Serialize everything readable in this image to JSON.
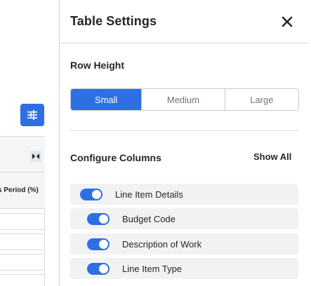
{
  "background_table": {
    "header_label": "s Period (%)"
  },
  "panel": {
    "title": "Table Settings",
    "close_icon": "close-icon",
    "row_height": {
      "label": "Row Height",
      "options": [
        "Small",
        "Medium",
        "Large"
      ],
      "selected": "Small"
    },
    "configure_columns": {
      "label": "Configure Columns",
      "show_all_label": "Show All",
      "items": [
        {
          "label": "Line Item Details",
          "enabled": true
        },
        {
          "label": "Budget Code",
          "enabled": true
        },
        {
          "label": "Description of Work",
          "enabled": true
        },
        {
          "label": "Line Item Type",
          "enabled": true
        }
      ]
    }
  },
  "colors": {
    "accent": "#2f6fe4",
    "row_bg": "#f1f2f3",
    "border": "#d6dadc"
  }
}
